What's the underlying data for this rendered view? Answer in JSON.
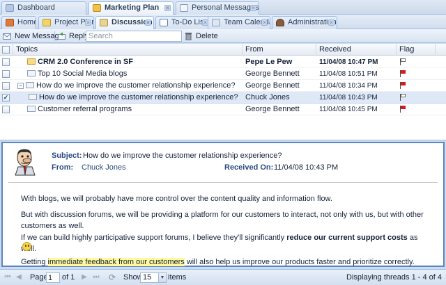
{
  "tabs_top": [
    {
      "label": "Dashboard",
      "icon": "dashboard-icon",
      "active": false
    },
    {
      "label": "Marketing Plan",
      "icon": "marketing-icon",
      "active": true
    },
    {
      "label": "Personal Messages",
      "icon": "envelope-icon",
      "active": false
    }
  ],
  "tabs_sub": [
    {
      "label": "Home",
      "icon": "home-icon",
      "active": false
    },
    {
      "label": "Project Plan",
      "icon": "document-icon",
      "active": false
    },
    {
      "label": "Discussion",
      "icon": "discussion-icon",
      "active": true
    },
    {
      "label": "To-Do List",
      "icon": "checklist-icon",
      "active": false
    },
    {
      "label": "Team Calendar",
      "icon": "calendar-icon",
      "active": false
    },
    {
      "label": "Administration",
      "icon": "admin-user-icon",
      "active": false
    }
  ],
  "toolbar": {
    "new_message": "New Message",
    "reply": "Reply",
    "search_placeholder": "Search",
    "delete": "Delete"
  },
  "grid": {
    "headers": {
      "topics": "Topics",
      "from": "From",
      "received": "Received",
      "flag": "Flag"
    },
    "rows": [
      {
        "topic": "CRM 2.0 Conference in SF",
        "from": "Pepe Le Pew",
        "received": "11/04/08 10:47 PM",
        "unread": true,
        "checked": false,
        "indent": 0,
        "expander": "",
        "flag": "white"
      },
      {
        "topic": "Top 10 Social Media blogs",
        "from": "George Bennett",
        "received": "11/04/08 10:51 PM",
        "unread": false,
        "checked": false,
        "indent": 0,
        "expander": "",
        "flag": "red"
      },
      {
        "topic": "How do we improve the customer relationship experience?",
        "from": "George Bennett",
        "received": "11/04/08 10:34 PM",
        "unread": false,
        "checked": false,
        "indent": 0,
        "expander": "−",
        "flag": "red"
      },
      {
        "topic": "How do we improve the customer relationship experience?",
        "from": "Chuck Jones",
        "received": "11/04/08 10:43 PM",
        "unread": false,
        "checked": true,
        "indent": 1,
        "expander": "",
        "flag": "white"
      },
      {
        "topic": "Customer referral programs",
        "from": "George Bennett",
        "received": "11/04/08 10:45 PM",
        "unread": false,
        "checked": false,
        "indent": 0,
        "expander": "",
        "flag": "red"
      }
    ]
  },
  "preview": {
    "subject_label": "Subject:",
    "subject": "How do we improve the customer relationship experience?",
    "from_label": "From:",
    "from": "Chuck Jones",
    "received_label": "Received On:",
    "received": "11/04/08 10:43 PM",
    "p1": "With blogs, we will probably have more control over the content quality and information flow.",
    "p2": "But with discussion forums, we will be providing a platform for our customers to interact, not only with us, but with other customers as well.",
    "p3_a": "If we can build highly participative support forums, I believe they'll significantly ",
    "p3_b": "reduce our current support costs",
    "p3_c": " as well.",
    "p4_a": "Getting ",
    "p4_b": "immediate feedback from our customers",
    "p4_c": " will also help us improve our products faster and prioritize correctly."
  },
  "pager": {
    "page_label": "Page",
    "page": "1",
    "of_label": "of 1",
    "show_label": "Show",
    "page_size": "15",
    "items_label": "items",
    "status": "Displaying threads 1 - 4 of 4"
  },
  "colors": {
    "accent": "#99bbe8",
    "link": "#2a4b82",
    "flag_red": "#d31c1c",
    "highlight": "#fff89c"
  }
}
